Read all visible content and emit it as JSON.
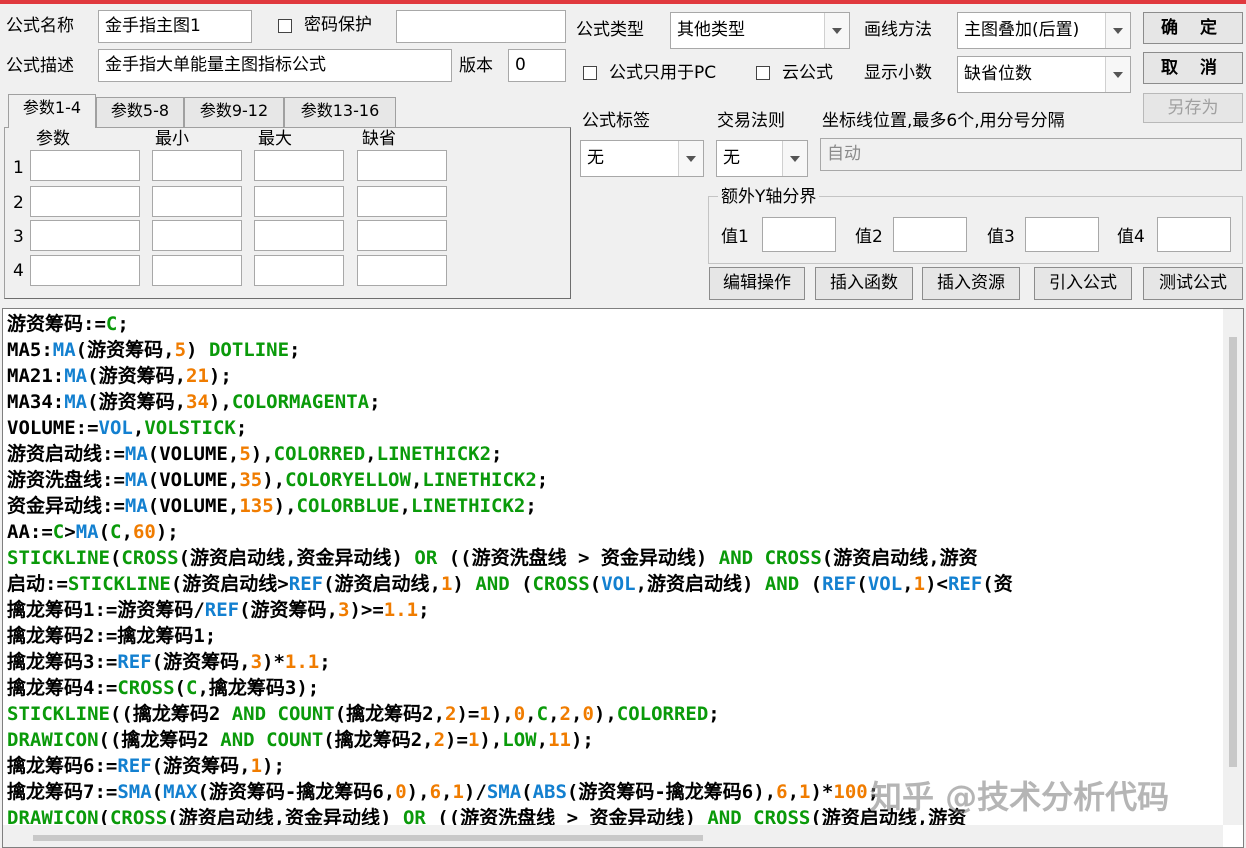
{
  "window": {
    "formula_name_label": "公式名称",
    "formula_name_value": "金手指主图1",
    "password_label": "密码保护",
    "password_value": "",
    "desc_label": "公式描述",
    "desc_value": "金手指大单能量主图指标公式",
    "version_label": "版本",
    "version_value": "0",
    "type_label": "公式类型",
    "type_value": "其他类型",
    "draw_label": "画线方法",
    "draw_value": "主图叠加(后置)",
    "pc_only_label": "公式只用于PC",
    "cloud_label": "云公式",
    "decimals_label": "显示小数",
    "decimals_value": "缺省位数",
    "ok_button": "确 定",
    "cancel_button": "取 消",
    "save_as_button": "另存为"
  },
  "params": {
    "tabs": [
      "参数1-4",
      "参数5-8",
      "参数9-12",
      "参数13-16"
    ],
    "headers": [
      "参数",
      "最小",
      "最大",
      "缺省"
    ],
    "rows": [
      "1",
      "2",
      "3",
      "4"
    ]
  },
  "settings": {
    "tag_label": "公式标签",
    "tag_value": "无",
    "trade_label": "交易法则",
    "trade_value": "无",
    "axis_label": "坐标线位置,最多6个,用分号分隔",
    "axis_value": "自动",
    "yaxis_group_label": "额外Y轴分界",
    "y_values": [
      "值1",
      "值2",
      "值3",
      "值4"
    ]
  },
  "toolbar": {
    "edit": "编辑操作",
    "insert_func": "插入函数",
    "insert_res": "插入资源",
    "import": "引入公式",
    "test": "测试公式"
  },
  "colors": {
    "var": "#000000",
    "keyword": "#0a9a0a",
    "function": "#1380d0",
    "number": "#f07c00",
    "titlebar": "#e0393e"
  },
  "code_lines": [
    [
      [
        "v",
        "游资筹码"
      ],
      [
        "o",
        ":="
      ],
      [
        "k",
        "C"
      ],
      [
        "o",
        ";"
      ]
    ],
    [
      [
        "v",
        "MA5"
      ],
      [
        "o",
        ":"
      ],
      [
        "f",
        "MA"
      ],
      [
        "o",
        "("
      ],
      [
        "v",
        "游资筹码"
      ],
      [
        "o",
        ","
      ],
      [
        "n",
        "5"
      ],
      [
        "o",
        ") "
      ],
      [
        "k",
        "DOTLINE"
      ],
      [
        "o",
        ";"
      ]
    ],
    [
      [
        "v",
        "MA21"
      ],
      [
        "o",
        ":"
      ],
      [
        "f",
        "MA"
      ],
      [
        "o",
        "("
      ],
      [
        "v",
        "游资筹码"
      ],
      [
        "o",
        ","
      ],
      [
        "n",
        "21"
      ],
      [
        "o",
        ");"
      ]
    ],
    [
      [
        "v",
        "MA34"
      ],
      [
        "o",
        ":"
      ],
      [
        "f",
        "MA"
      ],
      [
        "o",
        "("
      ],
      [
        "v",
        "游资筹码"
      ],
      [
        "o",
        ","
      ],
      [
        "n",
        "34"
      ],
      [
        "o",
        "),"
      ],
      [
        "k",
        "COLORMAGENTA"
      ],
      [
        "o",
        ";"
      ]
    ],
    [
      [
        "v",
        "VOLUME"
      ],
      [
        "o",
        ":="
      ],
      [
        "f",
        "VOL"
      ],
      [
        "o",
        ","
      ],
      [
        "k",
        "VOLSTICK"
      ],
      [
        "o",
        ";"
      ]
    ],
    [
      [
        "v",
        "游资启动线"
      ],
      [
        "o",
        ":="
      ],
      [
        "f",
        "MA"
      ],
      [
        "o",
        "(VOLUME,"
      ],
      [
        "n",
        "5"
      ],
      [
        "o",
        "),"
      ],
      [
        "k",
        "COLORRED"
      ],
      [
        "o",
        ","
      ],
      [
        "k",
        "LINETHICK2"
      ],
      [
        "o",
        ";"
      ]
    ],
    [
      [
        "v",
        "游资洗盘线"
      ],
      [
        "o",
        ":="
      ],
      [
        "f",
        "MA"
      ],
      [
        "o",
        "(VOLUME,"
      ],
      [
        "n",
        "35"
      ],
      [
        "o",
        "),"
      ],
      [
        "k",
        "COLORYELLOW"
      ],
      [
        "o",
        ","
      ],
      [
        "k",
        "LINETHICK2"
      ],
      [
        "o",
        ";"
      ]
    ],
    [
      [
        "v",
        "资金异动线"
      ],
      [
        "o",
        ":="
      ],
      [
        "f",
        "MA"
      ],
      [
        "o",
        "(VOLUME,"
      ],
      [
        "n",
        "135"
      ],
      [
        "o",
        "),"
      ],
      [
        "k",
        "COLORBLUE"
      ],
      [
        "o",
        ","
      ],
      [
        "k",
        "LINETHICK2"
      ],
      [
        "o",
        ";"
      ]
    ],
    [
      [
        "v",
        "AA"
      ],
      [
        "o",
        ":="
      ],
      [
        "k",
        "C"
      ],
      [
        "o",
        ">"
      ],
      [
        "f",
        "MA"
      ],
      [
        "o",
        "("
      ],
      [
        "k",
        "C"
      ],
      [
        "o",
        ","
      ],
      [
        "n",
        "60"
      ],
      [
        "o",
        ");"
      ]
    ],
    [
      [
        "k",
        "STICKLINE"
      ],
      [
        "o",
        "("
      ],
      [
        "k",
        "CROSS"
      ],
      [
        "o",
        "(游资启动线,资金异动线) "
      ],
      [
        "k",
        "OR"
      ],
      [
        "o",
        " ((游资洗盘线 > 资金异动线) "
      ],
      [
        "k",
        "AND"
      ],
      [
        "o",
        " "
      ],
      [
        "k",
        "CROSS"
      ],
      [
        "o",
        "(游资启动线,游资"
      ]
    ],
    [
      [
        "v",
        "启动"
      ],
      [
        "o",
        ":="
      ],
      [
        "k",
        "STICKLINE"
      ],
      [
        "o",
        "(游资启动线>"
      ],
      [
        "f",
        "REF"
      ],
      [
        "o",
        "(游资启动线,"
      ],
      [
        "n",
        "1"
      ],
      [
        "o",
        ") "
      ],
      [
        "k",
        "AND"
      ],
      [
        "o",
        " ("
      ],
      [
        "k",
        "CROSS"
      ],
      [
        "o",
        "("
      ],
      [
        "f",
        "VOL"
      ],
      [
        "o",
        ",游资启动线) "
      ],
      [
        "k",
        "AND"
      ],
      [
        "o",
        " ("
      ],
      [
        "f",
        "REF"
      ],
      [
        "o",
        "("
      ],
      [
        "f",
        "VOL"
      ],
      [
        "o",
        ","
      ],
      [
        "n",
        "1"
      ],
      [
        "o",
        ")<"
      ],
      [
        "f",
        "REF"
      ],
      [
        "o",
        "(资"
      ]
    ],
    [
      [
        "v",
        "擒龙筹码1"
      ],
      [
        "o",
        ":=游资筹码/"
      ],
      [
        "f",
        "REF"
      ],
      [
        "o",
        "(游资筹码,"
      ],
      [
        "n",
        "3"
      ],
      [
        "o",
        ")>="
      ],
      [
        "n",
        "1.1"
      ],
      [
        "o",
        ";"
      ]
    ],
    [
      [
        "v",
        "擒龙筹码2"
      ],
      [
        "o",
        ":=擒龙筹码1;"
      ]
    ],
    [
      [
        "v",
        "擒龙筹码3"
      ],
      [
        "o",
        ":="
      ],
      [
        "f",
        "REF"
      ],
      [
        "o",
        "(游资筹码,"
      ],
      [
        "n",
        "3"
      ],
      [
        "o",
        ")*"
      ],
      [
        "n",
        "1.1"
      ],
      [
        "o",
        ";"
      ]
    ],
    [
      [
        "v",
        "擒龙筹码4"
      ],
      [
        "o",
        ":="
      ],
      [
        "k",
        "CROSS"
      ],
      [
        "o",
        "("
      ],
      [
        "k",
        "C"
      ],
      [
        "o",
        ",擒龙筹码3);"
      ]
    ],
    [
      [
        "k",
        "STICKLINE"
      ],
      [
        "o",
        "((擒龙筹码2 "
      ],
      [
        "k",
        "AND"
      ],
      [
        "o",
        " "
      ],
      [
        "k",
        "COUNT"
      ],
      [
        "o",
        "(擒龙筹码2,"
      ],
      [
        "n",
        "2"
      ],
      [
        "o",
        ")="
      ],
      [
        "n",
        "1"
      ],
      [
        "o",
        "),"
      ],
      [
        "n",
        "0"
      ],
      [
        "o",
        ","
      ],
      [
        "k",
        "C"
      ],
      [
        "o",
        ","
      ],
      [
        "n",
        "2"
      ],
      [
        "o",
        ","
      ],
      [
        "n",
        "0"
      ],
      [
        "o",
        "),"
      ],
      [
        "k",
        "COLORRED"
      ],
      [
        "o",
        ";"
      ]
    ],
    [
      [
        "k",
        "DRAWICON"
      ],
      [
        "o",
        "((擒龙筹码2 "
      ],
      [
        "k",
        "AND"
      ],
      [
        "o",
        " "
      ],
      [
        "k",
        "COUNT"
      ],
      [
        "o",
        "(擒龙筹码2,"
      ],
      [
        "n",
        "2"
      ],
      [
        "o",
        ")="
      ],
      [
        "n",
        "1"
      ],
      [
        "o",
        "),"
      ],
      [
        "k",
        "LOW"
      ],
      [
        "o",
        ","
      ],
      [
        "n",
        "11"
      ],
      [
        "o",
        ");"
      ]
    ],
    [
      [
        "v",
        "擒龙筹码6"
      ],
      [
        "o",
        ":="
      ],
      [
        "f",
        "REF"
      ],
      [
        "o",
        "(游资筹码,"
      ],
      [
        "n",
        "1"
      ],
      [
        "o",
        ");"
      ]
    ],
    [
      [
        "v",
        "擒龙筹码7"
      ],
      [
        "o",
        ":="
      ],
      [
        "f",
        "SMA"
      ],
      [
        "o",
        "("
      ],
      [
        "f",
        "MAX"
      ],
      [
        "o",
        "(游资筹码-擒龙筹码6,"
      ],
      [
        "n",
        "0"
      ],
      [
        "o",
        "),"
      ],
      [
        "n",
        "6"
      ],
      [
        "o",
        ","
      ],
      [
        "n",
        "1"
      ],
      [
        "o",
        ")/"
      ],
      [
        "f",
        "SMA"
      ],
      [
        "o",
        "("
      ],
      [
        "f",
        "ABS"
      ],
      [
        "o",
        "(游资筹码-擒龙筹码6),"
      ],
      [
        "n",
        "6"
      ],
      [
        "o",
        ","
      ],
      [
        "n",
        "1"
      ],
      [
        "o",
        ")*"
      ],
      [
        "n",
        "100"
      ],
      [
        "o",
        ";"
      ]
    ],
    [
      [
        "k",
        "DRAWICON"
      ],
      [
        "o",
        "("
      ],
      [
        "k",
        "CROSS"
      ],
      [
        "o",
        "(游资启动线,资金异动线) "
      ],
      [
        "k",
        "OR"
      ],
      [
        "o",
        " ((游资洗盘线 > 资金异动线) "
      ],
      [
        "k",
        "AND"
      ],
      [
        "o",
        " "
      ],
      [
        "k",
        "CROSS"
      ],
      [
        "o",
        "(游资启动线,游资"
      ]
    ]
  ],
  "watermark": "知乎 @技术分析代码"
}
